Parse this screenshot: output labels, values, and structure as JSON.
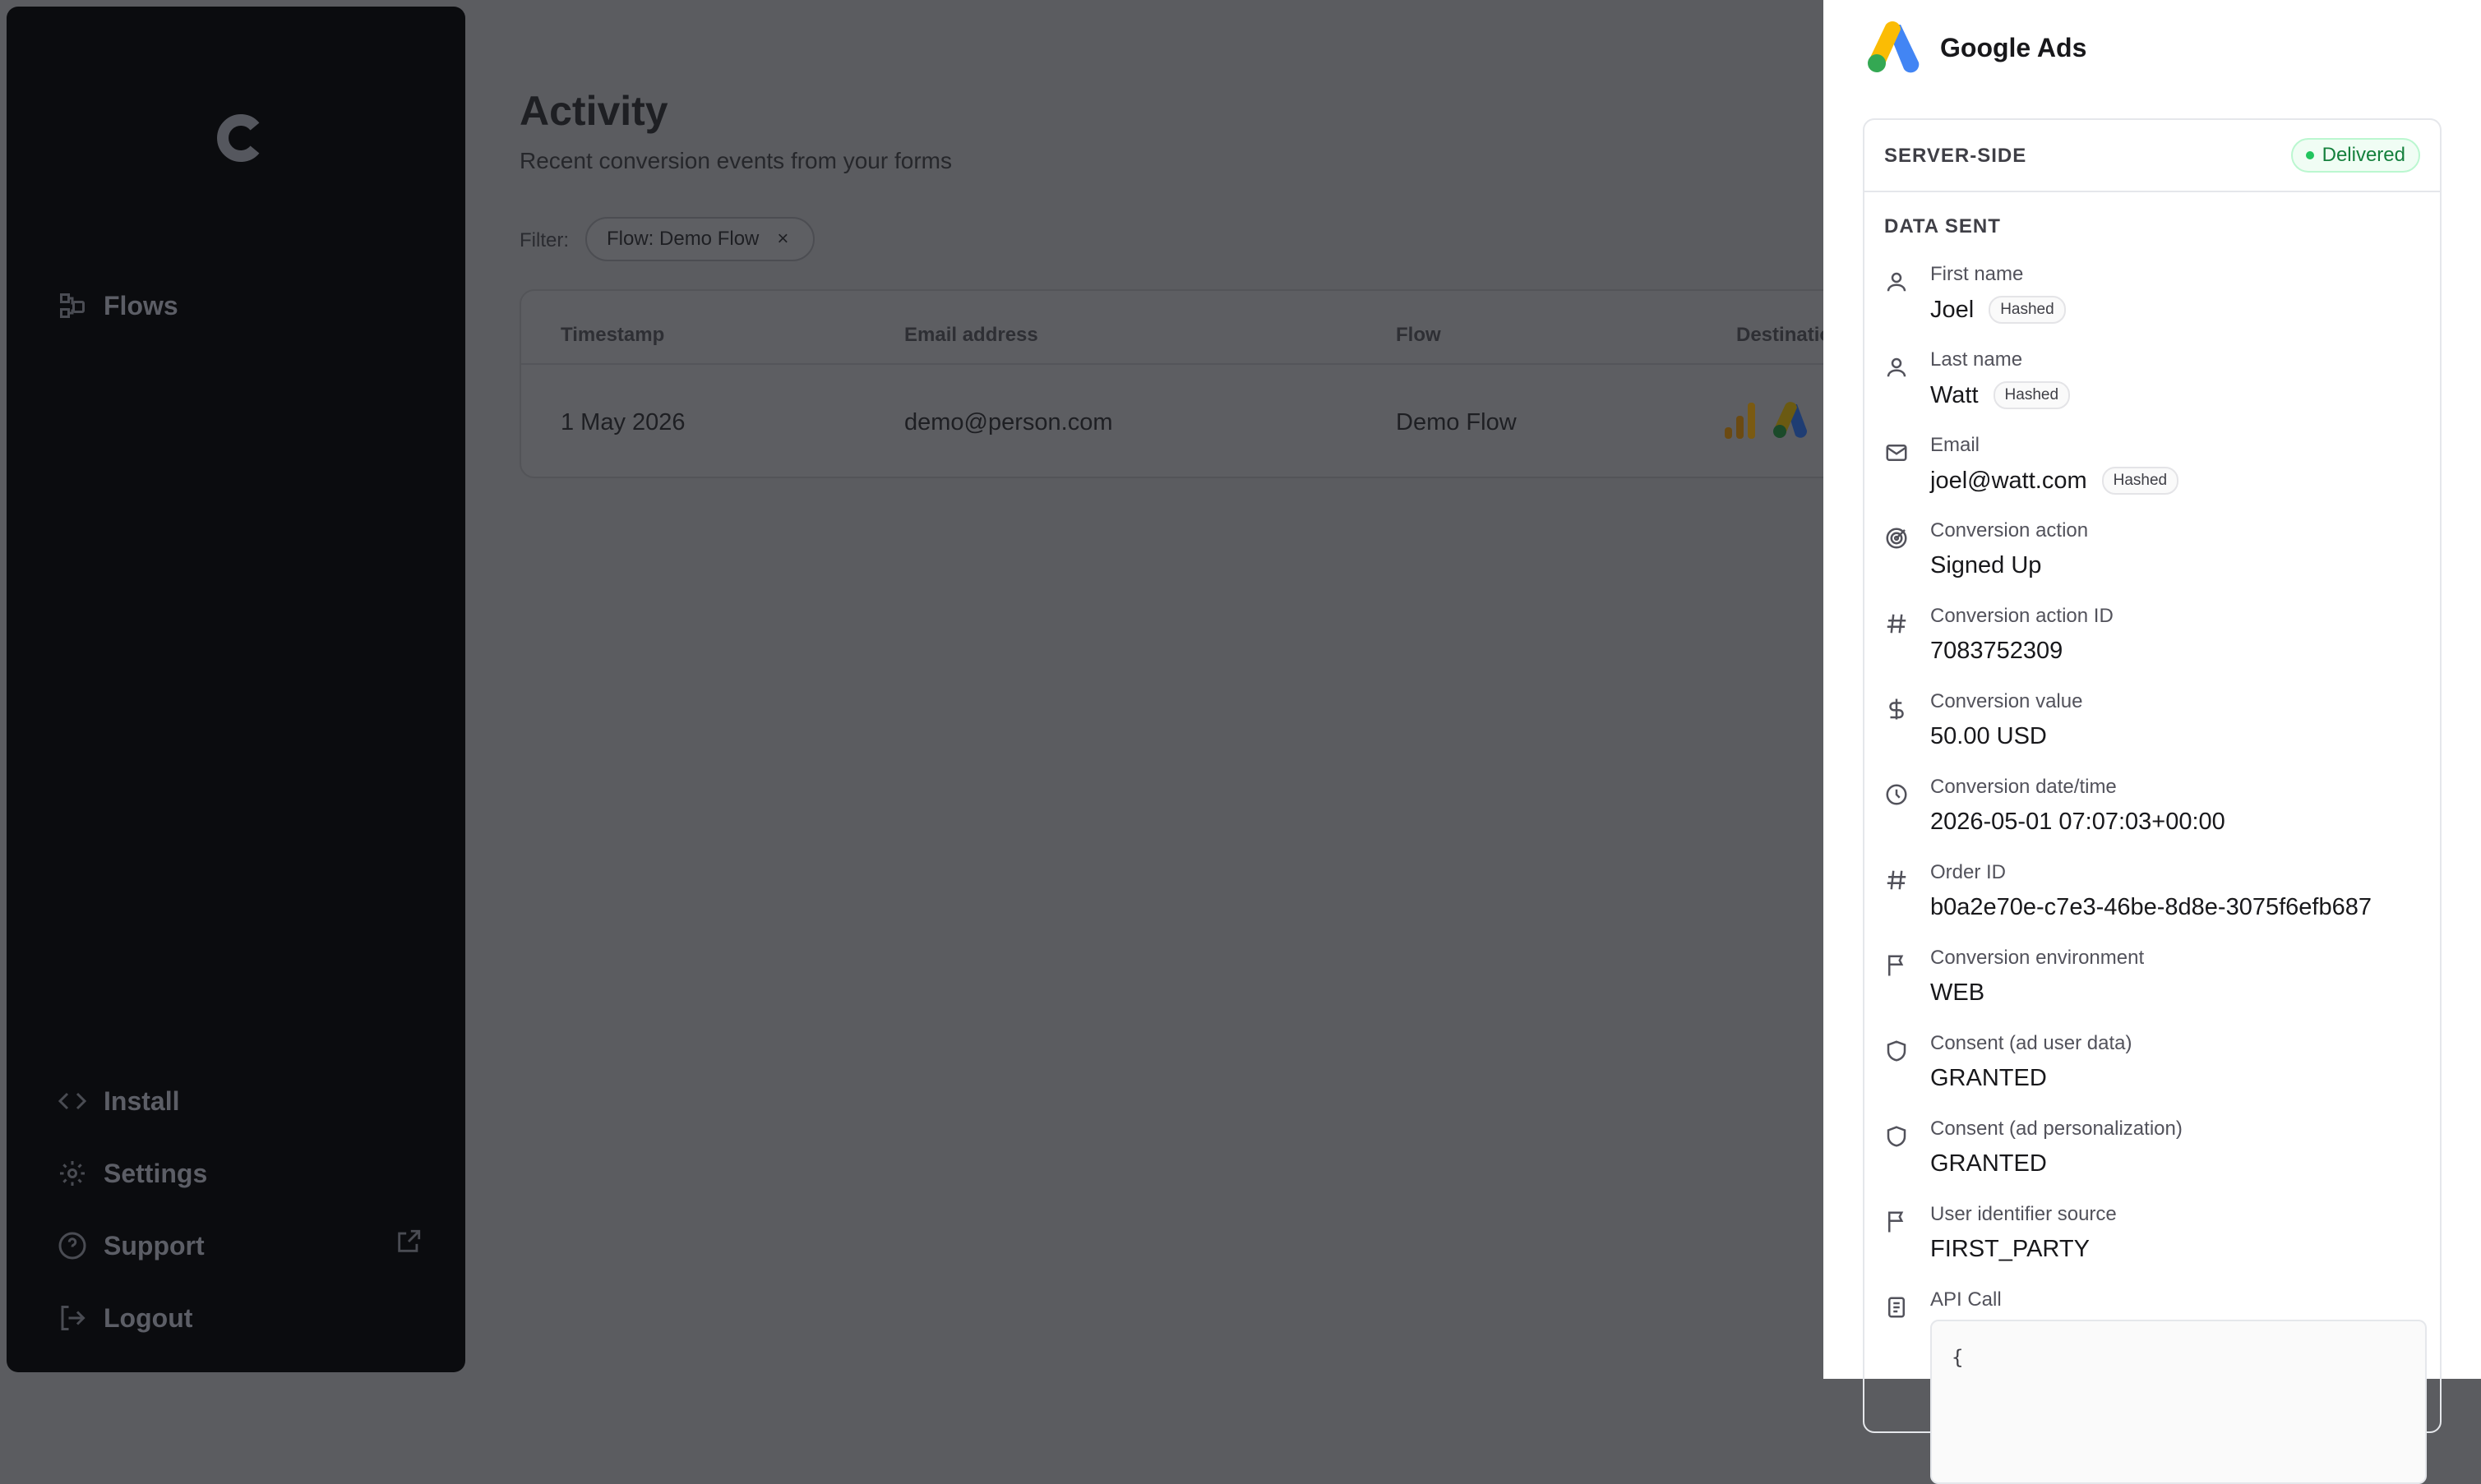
{
  "sidebar": {
    "items": [
      {
        "label": "Flows",
        "icon": "flows-icon"
      },
      {
        "label": "Install",
        "icon": "code-icon"
      },
      {
        "label": "Settings",
        "icon": "gear-icon"
      },
      {
        "label": "Support",
        "icon": "help-circle-icon"
      },
      {
        "label": "Logout",
        "icon": "logout-icon"
      }
    ]
  },
  "main": {
    "title": "Activity",
    "subtitle": "Recent conversion events from your forms",
    "filter": {
      "label": "Filter:",
      "chip": "Flow: Demo Flow",
      "remove": "×"
    },
    "table": {
      "columns": [
        "Timestamp",
        "Email address",
        "Flow",
        "Destinatio"
      ],
      "rows": [
        {
          "timestamp": "1 May 2026",
          "email": "demo@person.com",
          "flow": "Demo Flow"
        }
      ]
    }
  },
  "drawer": {
    "title": "Google Ads",
    "kind": "SERVER-SIDE",
    "status": "Delivered",
    "section": "DATA SENT",
    "fields": [
      {
        "label": "First name",
        "value": "Joel",
        "hashed": "Hashed",
        "icon": "user-icon"
      },
      {
        "label": "Last name",
        "value": "Watt",
        "hashed": "Hashed",
        "icon": "user-icon"
      },
      {
        "label": "Email",
        "value": "joel@watt.com",
        "hashed": "Hashed",
        "icon": "mail-icon"
      },
      {
        "label": "Conversion action",
        "value": "Signed Up",
        "icon": "target-icon"
      },
      {
        "label": "Conversion action ID",
        "value": "7083752309",
        "icon": "hash-icon"
      },
      {
        "label": "Conversion value",
        "value": "50.00 USD",
        "icon": "dollar-icon"
      },
      {
        "label": "Conversion date/time",
        "value": "2026-05-01 07:07:03+00:00",
        "icon": "clock-icon"
      },
      {
        "label": "Order ID",
        "value": "b0a2e70e-c7e3-46be-8d8e-3075f6efb687",
        "icon": "hash-icon"
      },
      {
        "label": "Conversion environment",
        "value": "WEB",
        "icon": "flag-icon"
      },
      {
        "label": "Consent (ad user data)",
        "value": "GRANTED",
        "icon": "shield-icon"
      },
      {
        "label": "Consent (ad personalization)",
        "value": "GRANTED",
        "icon": "shield-icon"
      },
      {
        "label": "User identifier source",
        "value": "FIRST_PARTY",
        "icon": "flag-icon"
      },
      {
        "label": "API Call",
        "icon": "document-icon"
      }
    ],
    "code_preview": "{"
  }
}
